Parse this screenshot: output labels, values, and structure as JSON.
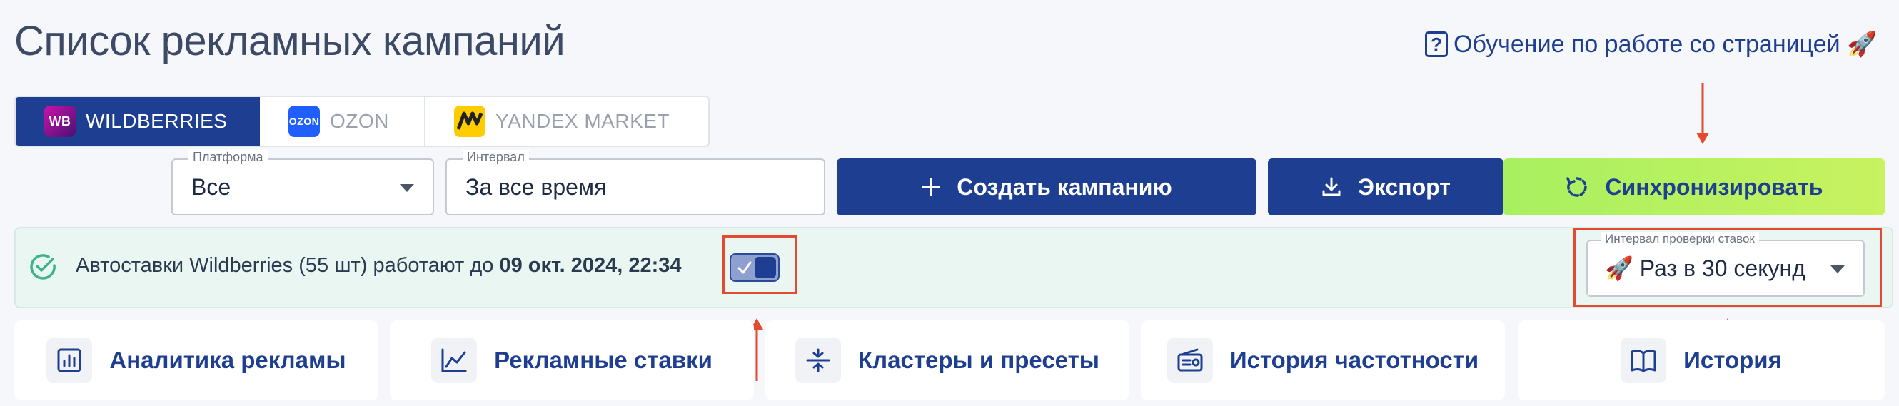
{
  "header": {
    "title": "Список рекламных кампаний",
    "help_link": "Обучение по работе со страницей 🚀"
  },
  "marketplaces": {
    "tabs": [
      {
        "label": "WILDBERRIES",
        "logo_text": "WB",
        "active": true
      },
      {
        "label": "OZON",
        "logo_text": "OZON",
        "active": false
      },
      {
        "label": "YANDEX MARKET",
        "logo_text": "M",
        "active": false
      }
    ]
  },
  "filters": {
    "platform": {
      "label": "Платформа",
      "value": "Все"
    },
    "interval": {
      "label": "Интервал",
      "value": "За все время"
    }
  },
  "actions": {
    "create": "Создать кампанию",
    "export": "Экспорт",
    "sync": "Синхронизировать"
  },
  "status": {
    "text": "Автоставки Wildberries (55 шт) работают до ",
    "until": "09 окт. 2024, 22:34",
    "toggle_on": true
  },
  "bid_check": {
    "label": "Интервал проверки ставок",
    "value": "🚀 Раз в 30 секунд"
  },
  "cards": [
    {
      "label": "Аналитика рекламы",
      "icon": "analytics-icon"
    },
    {
      "label": "Рекламные ставки",
      "icon": "line-chart-icon"
    },
    {
      "label": "Кластеры и пресеты",
      "icon": "clusters-icon"
    },
    {
      "label": "История частотности",
      "icon": "radio-icon"
    },
    {
      "label": "История",
      "icon": "book-icon"
    }
  ],
  "colors": {
    "primary": "#1e3f91",
    "sync": "#b4f060",
    "status_bg": "#eaf6f2",
    "annotation": "#e34a2f"
  }
}
